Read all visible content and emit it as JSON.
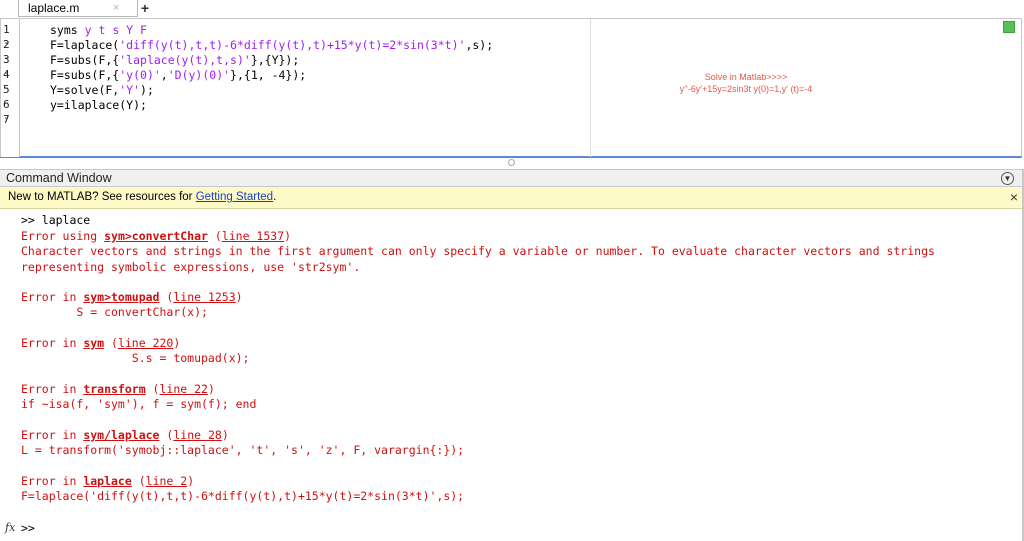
{
  "editor": {
    "tab": {
      "label": "laplace.m",
      "close_glyph": "×",
      "add_glyph": "+"
    },
    "line_numbers": [
      {
        "n": "1",
        "dash": "-"
      },
      {
        "n": "2",
        "dash": "-"
      },
      {
        "n": "3",
        "dash": "-"
      },
      {
        "n": "4",
        "dash": "-"
      },
      {
        "n": "5",
        "dash": "-"
      },
      {
        "n": "6",
        "dash": "-"
      },
      {
        "n": "7",
        "dash": ""
      }
    ],
    "lines": [
      [
        {
          "t": "syms y t s Y F",
          "c": "mixed_syms"
        }
      ],
      [
        {
          "t": "F=laplace(",
          "c": ""
        },
        {
          "t": "'diff(y(t),t,t)-6*diff(y(t),t)+15*y(t)=2*sin(3*t)'",
          "c": "str"
        },
        {
          "t": ",s);",
          "c": ""
        }
      ],
      [
        {
          "t": "F=subs(F,{",
          "c": ""
        },
        {
          "t": "'laplace(y(t),t,s)'",
          "c": "str"
        },
        {
          "t": "},{Y});",
          "c": ""
        }
      ],
      [
        {
          "t": "F=subs(F,{",
          "c": ""
        },
        {
          "t": "'y(0)'",
          "c": "str"
        },
        {
          "t": ",",
          "c": ""
        },
        {
          "t": "'D(y)(0)'",
          "c": "str"
        },
        {
          "t": "},{1, -4});",
          "c": ""
        }
      ],
      [
        {
          "t": "Y=solve(F,",
          "c": ""
        },
        {
          "t": "'Y'",
          "c": "str"
        },
        {
          "t": ");",
          "c": ""
        }
      ],
      [
        {
          "t": "y=ilaplace(Y);",
          "c": ""
        }
      ]
    ],
    "syms_keyword": "syms",
    "syms_args": "y t s Y F",
    "annotation": {
      "line1": "Solve in Matlab>>>>",
      "line2": "y''-6y'+15y=2sin3t  y(0)=1,y' (t)=-4"
    }
  },
  "command_window": {
    "title": "Command Window",
    "info_bar": {
      "text": "New to MATLAB? See resources for ",
      "link": "Getting Started",
      "suffix": ".",
      "close": "×"
    },
    "prompt": ">>",
    "fx_label": "fx",
    "output": {
      "cmd": ">> laplace",
      "e1": {
        "prefix": "Error using ",
        "fn": "sym>convertChar",
        "loc": "line 1537"
      },
      "msg1": "Character vectors and strings in the first argument can only specify a variable or number. To evaluate character vectors and strings",
      "msg2": "representing symbolic expressions, use 'str2sym'.",
      "e2": {
        "prefix": "Error in ",
        "fn": "sym>tomupad",
        "loc": "line 1253"
      },
      "c2": "        S = convertChar(x);",
      "e3": {
        "prefix": "Error in ",
        "fn": "sym",
        "loc": "line 220"
      },
      "c3": "                S.s = tomupad(x);",
      "e4": {
        "prefix": "Error in ",
        "fn": "transform",
        "loc": "line 22"
      },
      "c4": "if ~isa(f, 'sym'), f = sym(f); end",
      "e5": {
        "prefix": "Error in ",
        "fn": "sym/laplace",
        "loc": "line 28"
      },
      "c5": "L = transform('symobj::laplace', 't', 's', 'z', F, varargin{:});",
      "e6": {
        "prefix": "Error in ",
        "fn": "laplace",
        "loc": "line 2"
      },
      "c6": "F=laplace('diff(y(t),t,t)-6*diff(y(t),t)+15*y(t)=2*sin(3*t)',s);"
    }
  },
  "colors": {
    "error": "#d01010",
    "string": "#a020f0",
    "link": "#1a3fcf",
    "info_bg": "#fdfac7",
    "annotation": "#e05a4a"
  }
}
